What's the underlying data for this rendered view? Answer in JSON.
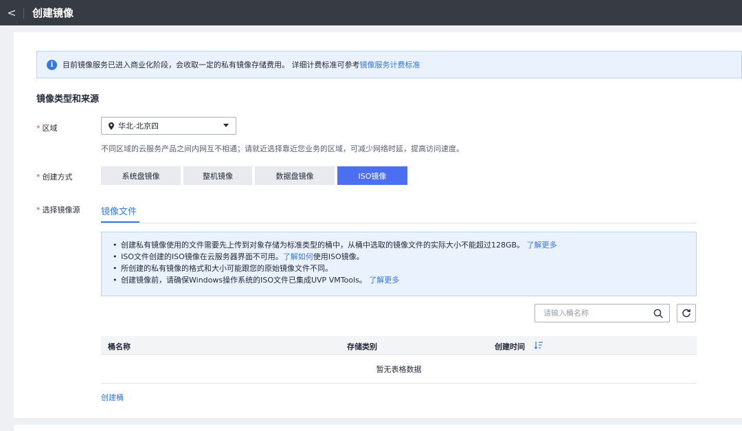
{
  "header": {
    "back_glyph": "<",
    "title": "创建镜像"
  },
  "notice": {
    "icon_glyph": "i",
    "text": "目前镜像服务已进入商业化阶段，会收取一定的私有镜像存储费用。 详细计费标准可参考",
    "link": "镜像服务计费标准"
  },
  "section": {
    "title": "镜像类型和来源"
  },
  "form": {
    "required_mark": "*",
    "region": {
      "label": "区域",
      "value": "华北-北京四",
      "hint": "不同区域的云服务产品之间内网互不相通；请就近选择靠近您业务的区域，可减少网络时延，提高访问速度。"
    },
    "creation_mode": {
      "label": "创建方式",
      "options": [
        "系统盘镜像",
        "整机镜像",
        "数据盘镜像",
        "ISO镜像"
      ],
      "selected": "ISO镜像"
    },
    "source": {
      "label": "选择镜像源",
      "tab": "镜像文件"
    }
  },
  "tips": {
    "item1_text": "创建私有镜像使用的文件需要先上传到对象存储为标准类型的桶中，从桶中选取的镜像文件的实际大小不能超过128GB。",
    "item1_link": "了解更多",
    "item2_pre": "ISO文件创建的ISO镜像在云服务器界面不可用。",
    "item2_link": "了解如何",
    "item2_post": "使用ISO镜像。",
    "item3_text": "所创建的私有镜像的格式和大小可能跟您的原始镜像文件不同。",
    "item4_text": "创建镜像前，请确保Windows操作系统的ISO文件已集成UVP VMTools。",
    "item4_link": "了解更多"
  },
  "search": {
    "placeholder": "请输入桶名称"
  },
  "table": {
    "columns": [
      "桶名称",
      "存储类别",
      "创建时间"
    ],
    "empty_text": "暂无表格数据"
  },
  "actions": {
    "create_bucket": "创建桶"
  },
  "colors": {
    "topbar": "#373b44",
    "accent": "#3677e0",
    "active_mode": "#4c6ef0",
    "required": "#e54545",
    "notice_bg": "#eaf2fd"
  },
  "icons": {
    "back": "chevron-left-icon",
    "info": "info-icon",
    "location": "location-pin-icon",
    "dropdown": "caret-down-icon",
    "search": "search-icon",
    "refresh": "refresh-icon",
    "sort": "sort-icon"
  }
}
